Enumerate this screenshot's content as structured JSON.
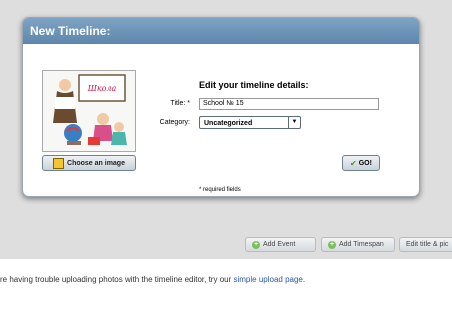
{
  "dialog": {
    "title": "New Timeline:",
    "choose_image_label": "Choose an image",
    "form_heading": "Edit your timeline details:",
    "title_label": "Title: *",
    "title_value": "School № 15",
    "category_label": "Category:",
    "category_value": "Uncategorized",
    "go_label": "GO!",
    "required_note": "* required fields",
    "thumbnail_sign": "Школа"
  },
  "toolbar": {
    "add_event": "Add Event",
    "add_timespan": "Add Timespan",
    "edit_title": "Edit title & pic"
  },
  "footer": {
    "text": "re having trouble uploading photos with the timeline editor, try our ",
    "link": "simple upload page",
    "end": "."
  },
  "colors": {
    "header": "#5e86ad",
    "link": "#2a58a8",
    "check": "#3c9a2b"
  }
}
